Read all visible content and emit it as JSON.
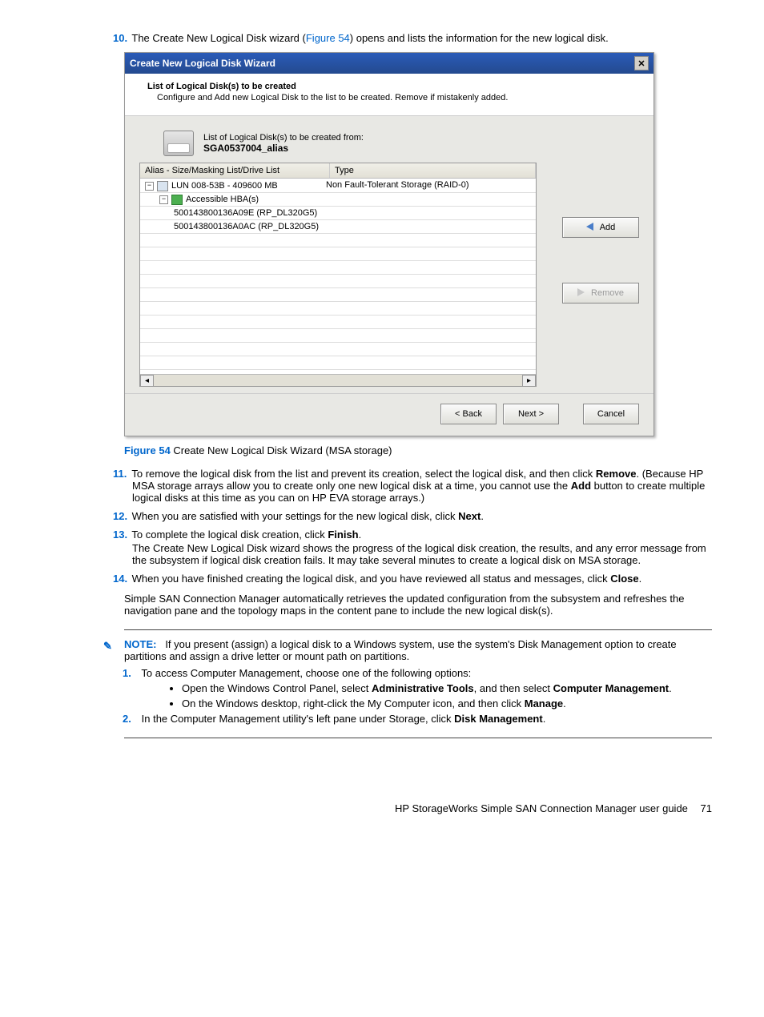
{
  "steps": {
    "s10": {
      "num": "10.",
      "text_a": "The Create New Logical Disk wizard (",
      "figref": "Figure 54",
      "text_b": ") opens and lists the information for the new logical disk."
    },
    "s11": {
      "num": "11.",
      "text_a": "To remove the logical disk from the list and prevent its creation, select the logical disk, and then click ",
      "b1": "Remove",
      "text_b": ". (Because HP MSA storage arrays allow you to create only one new logical disk at a time, you cannot use the ",
      "b2": "Add",
      "text_c": " button to create multiple logical disks at this time as you can on HP EVA storage arrays.)"
    },
    "s12": {
      "num": "12.",
      "text_a": "When you are satisfied with your settings for the new logical disk, click ",
      "b1": "Next",
      "text_b": "."
    },
    "s13": {
      "num": "13.",
      "text_a": "To complete the logical disk creation, click ",
      "b1": "Finish",
      "text_b": ".",
      "para": "The Create New Logical Disk wizard shows the progress of the logical disk creation, the results, and any error message from the subsystem if logical disk creation fails. It may take several minutes to create a logical disk on MSA storage."
    },
    "s14": {
      "num": "14.",
      "text_a": "When you have finished creating the logical disk, and you have reviewed all status and messages, click ",
      "b1": "Close",
      "text_b": "."
    }
  },
  "wizard": {
    "title": "Create New Logical Disk Wizard",
    "header_title": "List of Logical Disk(s) to be created",
    "header_desc": "Configure and Add new Logical Disk to the list to be created. Remove if mistakenly added.",
    "list_intro": "List of Logical Disk(s) to be created from:",
    "alias": "SGA0537004_alias",
    "col_alias": "Alias - Size/Masking List/Drive List",
    "col_type": "Type",
    "tree": {
      "lun": "LUN 008-53B - 409600 MB",
      "hba": "Accessible HBA(s)",
      "h1": "500143800136A09E (RP_DL320G5)",
      "h2": "500143800136A0AC (RP_DL320G5)"
    },
    "type_value": "Non Fault-Tolerant Storage (RAID-0)",
    "btn_add": "Add",
    "btn_remove": "Remove",
    "btn_back": "< Back",
    "btn_next": "Next >",
    "btn_cancel": "Cancel"
  },
  "figure": {
    "label": "Figure 54",
    "caption": " Create New Logical Disk Wizard (MSA storage)"
  },
  "auto_para": "Simple SAN Connection Manager automatically retrieves the updated configuration from the subsystem and refreshes the navigation pane and the topology maps in the content pane to include the new logical disk(s).",
  "note": {
    "label": "NOTE:",
    "text": "If you present (assign) a logical disk to a Windows system, use the system's Disk Management option to create partitions and assign a drive letter or mount path on partitions.",
    "n1": {
      "num": "1.",
      "text": "To access Computer Management, choose one of the following options:"
    },
    "b1": {
      "a": "Open the Windows Control Panel, select ",
      "s1": "Administrative Tools",
      "b": ", and then select ",
      "s2": "Computer Management",
      "c": "."
    },
    "b2": {
      "a": "On the Windows desktop, right-click the My Computer icon, and then click ",
      "s1": "Manage",
      "b": "."
    },
    "n2": {
      "num": "2.",
      "a": "In the Computer Management utility's left pane under Storage, click ",
      "s1": "Disk Management",
      "b": "."
    }
  },
  "footer": {
    "text": "HP StorageWorks Simple SAN Connection Manager user guide",
    "page": "71"
  }
}
